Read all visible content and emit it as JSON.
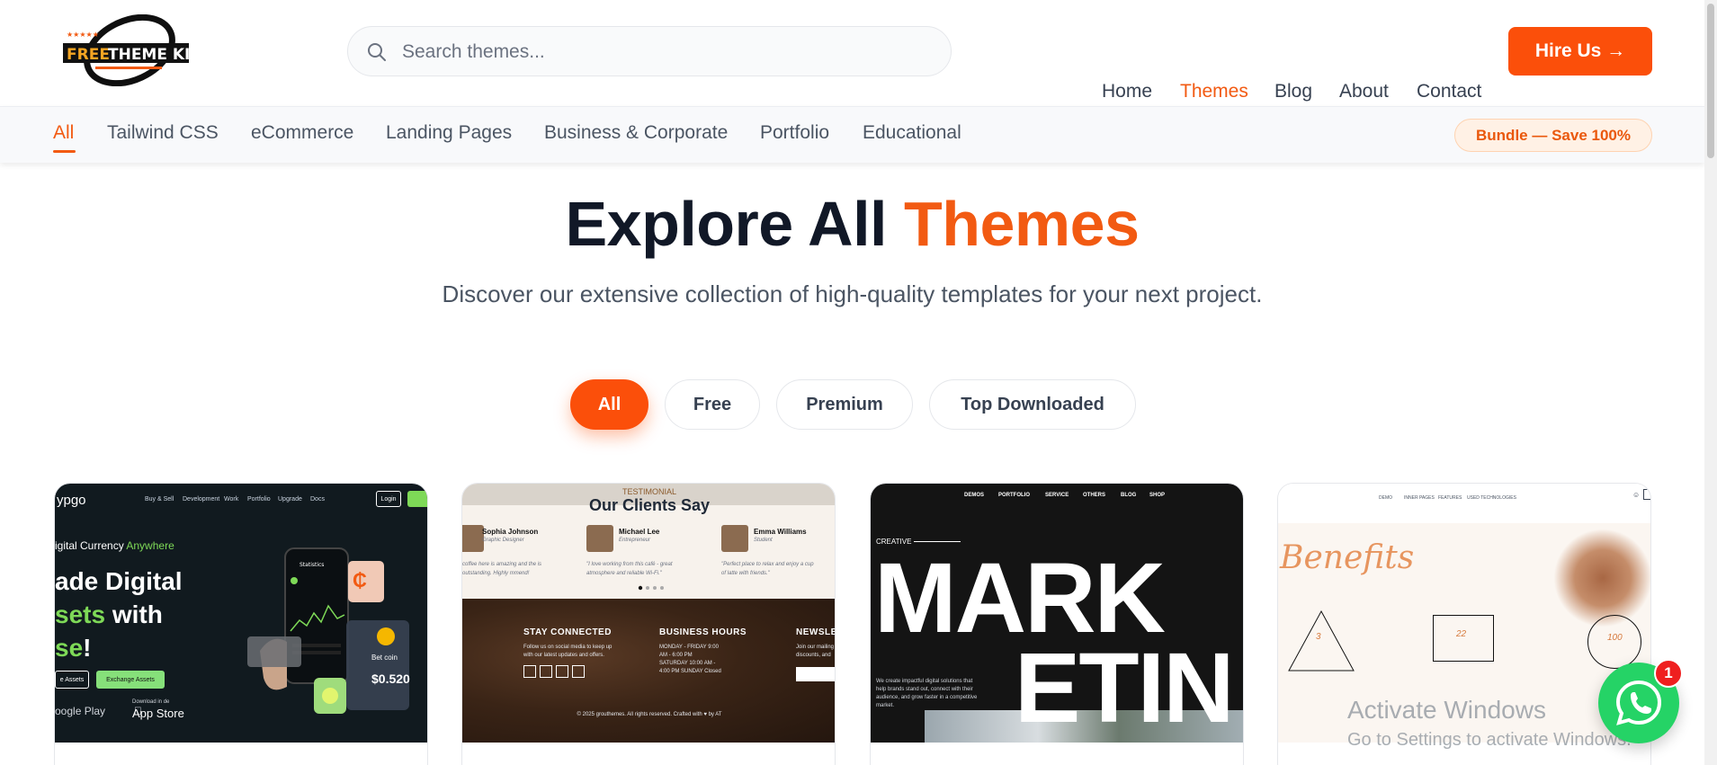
{
  "header": {
    "logo_text": "FREE THEME KIT",
    "search_placeholder": "Search themes...",
    "nav": [
      "Home",
      "Themes",
      "Blog",
      "About",
      "Contact"
    ],
    "active_nav": "Themes",
    "hire_label": "Hire Us →"
  },
  "categories": {
    "items": [
      "All",
      "Tailwind CSS",
      "eCommerce",
      "Landing Pages",
      "Business & Corporate",
      "Portfolio",
      "Educational"
    ],
    "active": "All",
    "bundle_label": "Bundle — Save 100%"
  },
  "hero": {
    "title_main": "Explore All ",
    "title_accent": "Themes",
    "subtitle": "Discover our extensive collection of high-quality templates for your next project."
  },
  "filters": {
    "items": [
      "All",
      "Free",
      "Premium",
      "Top Downloaded"
    ],
    "active": "All"
  },
  "cards": {
    "c1": {
      "brand": "ypgo",
      "nav": [
        "Buy & Sell",
        "Development",
        "Work",
        "Portfolio",
        "Upgrade",
        "Docs"
      ],
      "login": "Login",
      "eyebrow_a": "igital Currency ",
      "eyebrow_b": "Anywhere",
      "line1": "ade Digital",
      "line2a": "sets",
      "line2b": " with",
      "line3a": "se",
      "line3b": "!",
      "btn1": "e Assets",
      "btn2": "Exchange Assets",
      "store1": "oogle Play",
      "store2": "App Store",
      "store2_small": "Download in de",
      "coin_label": "Bet coin",
      "price": "$0.520"
    },
    "c2": {
      "testimonial": "TESTIMONIAL",
      "heading": "Our Clients Say",
      "people": [
        {
          "name": "Sophia Johnson",
          "role": "Graphic Designer",
          "quote": "coffee here is amazing and the is outstanding. Highly mmend!"
        },
        {
          "name": "Michael Lee",
          "role": "Entrepreneur",
          "quote": "\"I love working from this café - great atmosphere and reliable Wi-Fi.\""
        },
        {
          "name": "Emma Williams",
          "role": "Student",
          "quote": "\"Perfect place to relax and enjoy a cup of latte with friends.\""
        }
      ],
      "footer_cols": [
        "STAY CONNECTED",
        "BUSINESS HOURS",
        "NEWSLETT"
      ],
      "stay_text": "Follow us on social media to keep up with our latest updates and offers.",
      "hours_text": "MONDAY - FRIDAY 9:00 AM - 6:00 PM SATURDAY 10:00 AM - 4:00 PM SUNDAY Closed",
      "news_text": "Join our mailing discounts, and",
      "copy": "© 2025 grouthemes. All rights reserved. Crafted with ♥ by AT"
    },
    "c3": {
      "nav": [
        "DEMOS",
        "PORTFOLIO",
        "SERVICE",
        "OTHERS",
        "BLOG",
        "SHOP"
      ],
      "creative": "CREATIVE",
      "big1": "MARK",
      "big2": "ETIN",
      "desc": "We create impactful digital solutions that help brands stand out, connect with their audience, and grow faster in a competitive market."
    },
    "c4": {
      "nav": [
        "DEMO",
        "INNER PAGES",
        "FEATURES",
        "USED TECHNOLOGIES"
      ],
      "heading": "Benefits",
      "nums": [
        "3",
        "22",
        "100"
      ]
    }
  },
  "watermark": {
    "line1": "Activate Windows",
    "line2": "Go to Settings to activate Windows."
  },
  "whatsapp": {
    "badge": "1"
  },
  "colors": {
    "accent": "#f25a12",
    "button": "#fb4f0a",
    "whatsapp": "#25d366"
  }
}
